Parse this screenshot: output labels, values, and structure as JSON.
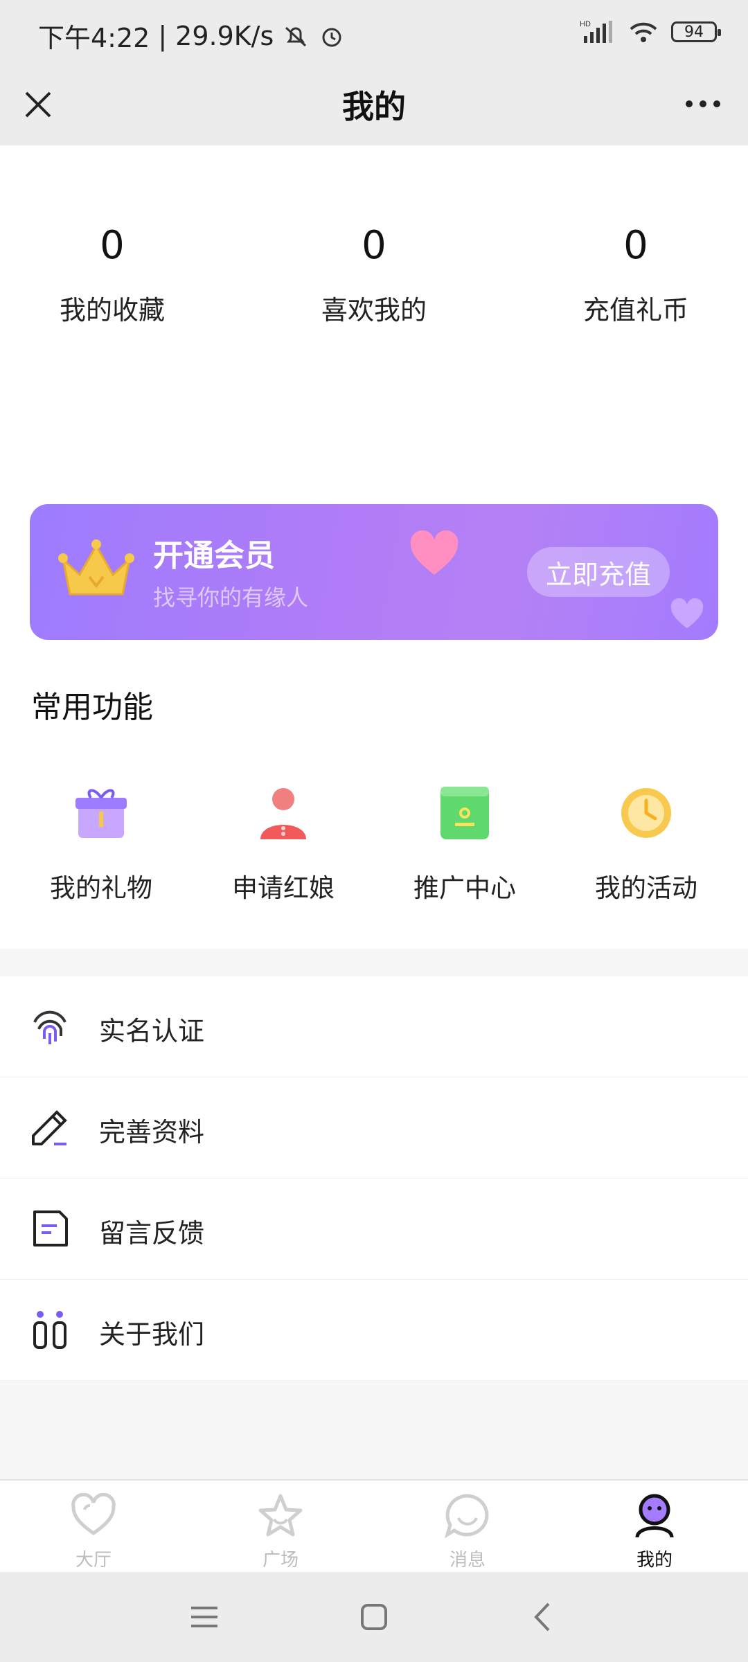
{
  "status_bar": {
    "time": "下午4:22",
    "speed": "29.9K/s",
    "battery": "94",
    "network": "HD"
  },
  "header": {
    "title": "我的"
  },
  "stats": [
    {
      "value": "0",
      "label": "我的收藏"
    },
    {
      "value": "0",
      "label": "喜欢我的"
    },
    {
      "value": "0",
      "label": "充值礼币"
    }
  ],
  "vip_banner": {
    "title": "开通会员",
    "subtitle": "找寻你的有缘人",
    "button": "立即充值"
  },
  "common_functions": {
    "title": "常用功能",
    "items": [
      {
        "label": "我的礼物",
        "icon": "gift-icon"
      },
      {
        "label": "申请红娘",
        "icon": "matchmaker-icon"
      },
      {
        "label": "推广中心",
        "icon": "promotion-icon"
      },
      {
        "label": "我的活动",
        "icon": "activity-icon"
      }
    ]
  },
  "menu_list": [
    {
      "label": "实名认证",
      "icon": "fingerprint-icon"
    },
    {
      "label": "完善资料",
      "icon": "edit-icon"
    },
    {
      "label": "留言反馈",
      "icon": "feedback-icon"
    },
    {
      "label": "关于我们",
      "icon": "about-icon"
    }
  ],
  "tab_bar": [
    {
      "label": "大厅",
      "icon": "heart-icon",
      "active": false
    },
    {
      "label": "广场",
      "icon": "star-icon",
      "active": false
    },
    {
      "label": "消息",
      "icon": "message-icon",
      "active": false
    },
    {
      "label": "我的",
      "icon": "profile-icon",
      "active": true
    }
  ],
  "colors": {
    "accent": "#a57bff",
    "tab_inactive": "#bdbdbd",
    "header_bg": "#ececec"
  }
}
